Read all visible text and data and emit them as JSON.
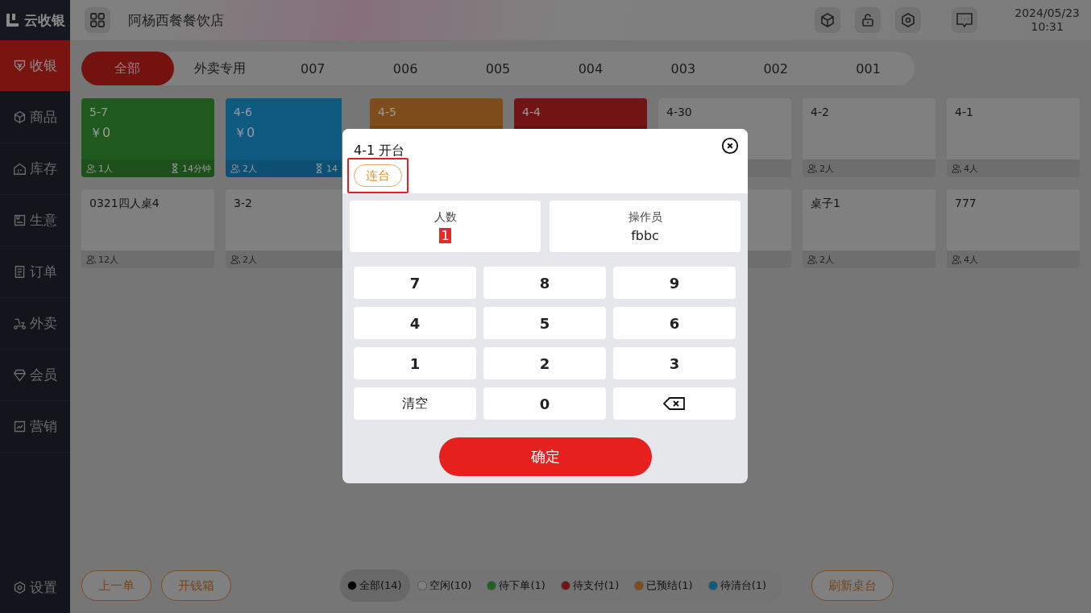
{
  "app": {
    "logo": "云收银"
  },
  "header": {
    "store_name": "阿杨西餐餐饮店",
    "date": "2024/05/23",
    "time": "10:31"
  },
  "sidebar": {
    "items": [
      {
        "label": "收银",
        "selected": true
      },
      {
        "label": "商品",
        "selected": false
      },
      {
        "label": "库存",
        "selected": false
      },
      {
        "label": "生意",
        "selected": false
      },
      {
        "label": "订单",
        "selected": false
      },
      {
        "label": "外卖",
        "selected": false
      },
      {
        "label": "会员",
        "selected": false
      },
      {
        "label": "营销",
        "selected": false
      }
    ],
    "settings": "设置"
  },
  "tabs": [
    {
      "label": "全部",
      "selected": true
    },
    {
      "label": "外卖专用",
      "selected": false
    },
    {
      "label": "007",
      "selected": false
    },
    {
      "label": "006",
      "selected": false
    },
    {
      "label": "005",
      "selected": false
    },
    {
      "label": "004",
      "selected": false
    },
    {
      "label": "003",
      "selected": false
    },
    {
      "label": "002",
      "selected": false
    },
    {
      "label": "001",
      "selected": false
    }
  ],
  "tables": [
    {
      "name": "5-7",
      "color": "#215a1f",
      "amount": "￥0",
      "guests": "1人",
      "timer": "14分钟"
    },
    {
      "name": "4-6",
      "color": "#0f5a80",
      "amount": "￥0",
      "guests": "2人",
      "timer": "14"
    },
    {
      "name": "4-5",
      "color": "#7f4d1c"
    },
    {
      "name": "4-4",
      "color": "#721414"
    },
    {
      "name": "4-30",
      "color": "#808080"
    },
    {
      "name": "4-2",
      "color": "#808080",
      "guests": "2人"
    },
    {
      "name": "4-1",
      "color": "#808080",
      "guests": "4人"
    },
    {
      "name": "0321四人桌4",
      "color": "#808080",
      "guests": "12人"
    },
    {
      "name": "3-2",
      "color": "#808080",
      "guests": "2人"
    },
    {
      "color": "#808080"
    },
    {
      "name": "桌子1",
      "color": "#808080",
      "guests": "2人"
    },
    {
      "name": "777",
      "color": "#808080",
      "guests": "4人"
    }
  ],
  "bottom_buttons": [
    "上一单",
    "开钱箱"
  ],
  "filters": [
    {
      "label": "全部(14)",
      "color": "#000000",
      "selected": true
    },
    {
      "label": "空闲(10)",
      "color": "#808080",
      "selected": false
    },
    {
      "label": "待下单(1)",
      "color": "#1f5f1f",
      "selected": false
    },
    {
      "label": "待支付(1)",
      "color": "#721414",
      "selected": false
    },
    {
      "label": "已预结(1)",
      "color": "#7f4d1c",
      "selected": false
    },
    {
      "label": "待清台(1)",
      "color": "#0f5a80",
      "selected": false
    }
  ],
  "refresh_button": "刷新桌台",
  "dialog": {
    "title": "4-1 开台",
    "join_button": "连台",
    "join_highlighted": true,
    "fields": [
      {
        "label": "人数",
        "value": "1",
        "selected": true
      },
      {
        "label": "操作员",
        "value": "fbbc",
        "selected": false
      }
    ],
    "keys": [
      {
        "kind": "digit",
        "label": "7"
      },
      {
        "kind": "digit",
        "label": "8"
      },
      {
        "kind": "digit",
        "label": "9"
      },
      {
        "kind": "digit",
        "label": "4"
      },
      {
        "kind": "digit",
        "label": "5"
      },
      {
        "kind": "digit",
        "label": "6"
      },
      {
        "kind": "digit",
        "label": "1"
      },
      {
        "kind": "digit",
        "label": "2"
      },
      {
        "kind": "digit",
        "label": "3"
      },
      {
        "kind": "clear",
        "label": "清空"
      },
      {
        "kind": "digit",
        "label": "0"
      },
      {
        "kind": "backspace"
      }
    ],
    "confirm": "确定"
  }
}
